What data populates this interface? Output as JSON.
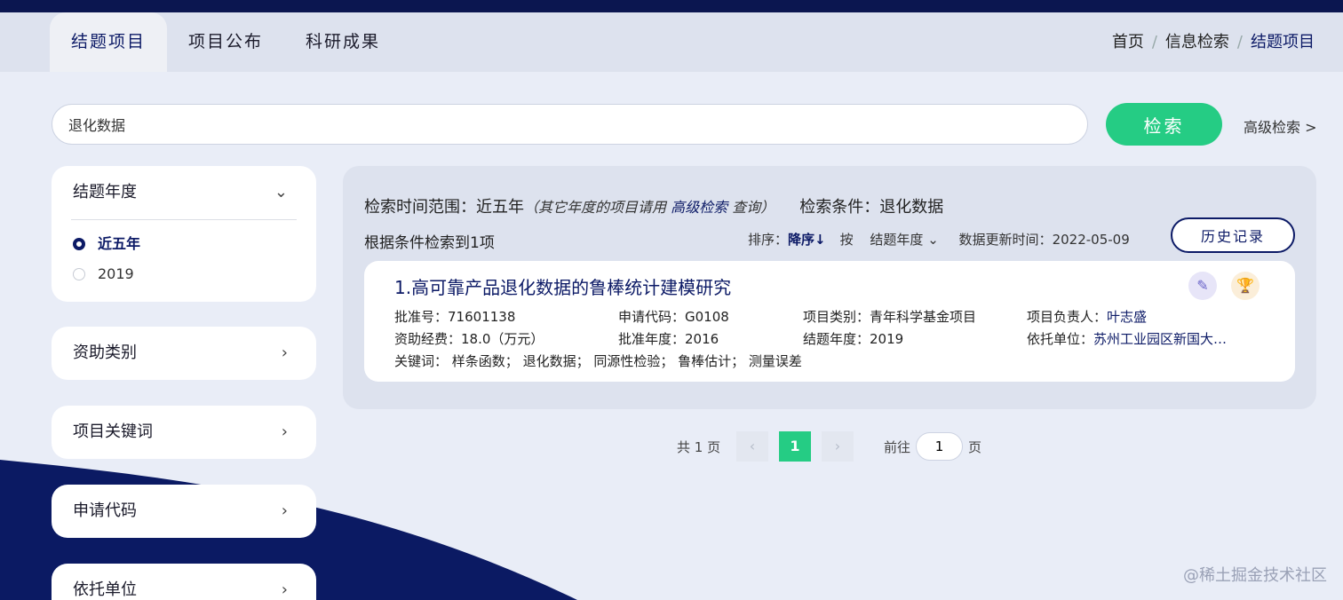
{
  "nav": {
    "tabs": [
      {
        "label": "结题项目"
      },
      {
        "label": "项目公布"
      },
      {
        "label": "科研成果"
      }
    ],
    "breadcrumb": [
      "首页",
      "信息检索",
      "结题项目"
    ],
    "breadcrumb_sep": "/"
  },
  "search": {
    "value": "退化数据",
    "button": "检索",
    "advanced": "高级检索 >"
  },
  "filters": {
    "year": {
      "title": "结题年度",
      "options": [
        "近五年",
        "2019"
      ],
      "selected": "近五年"
    },
    "collapsed": [
      "资助类别",
      "项目关键词",
      "申请代码",
      "依托单位"
    ]
  },
  "results": {
    "range_label": "检索时间范围：",
    "range_value": "近五年",
    "range_note_pre": "（其它年度的项目请用 ",
    "range_note_link": "高级检索",
    "range_note_post": " 查询）",
    "cond_label": "检索条件：",
    "cond_value": "退化数据",
    "count_text": "根据条件检索到1项",
    "sort_label": "排序：",
    "sort_dir": "降序↓",
    "by_label": "按",
    "by_field": "结题年度",
    "updated_label": "数据更新时间：",
    "updated_value": "2022-05-09",
    "history_button": "历史记录",
    "items": [
      {
        "title": "1.高可靠产品退化数据的鲁棒统计建模研究",
        "approval_no_label": "批准号：",
        "approval_no": "71601138",
        "apply_code_label": "申请代码：",
        "apply_code": "G0108",
        "category_label": "项目类别：",
        "category": "青年科学基金项目",
        "leader_label": "项目负责人：",
        "leader": "叶志盛",
        "funding_label": "资助经费：",
        "funding": "18.0（万元）",
        "approval_year_label": "批准年度：",
        "approval_year": "2016",
        "end_year_label": "结题年度：",
        "end_year": "2019",
        "unit_label": "依托单位：",
        "unit": "苏州工业园区新国大…",
        "keywords_label": "关键词：",
        "keywords": "样条函数； 退化数据； 同源性检验； 鲁棒估计； 测量误差"
      }
    ]
  },
  "pagination": {
    "total_text": "共 1 页",
    "current": "1",
    "goto_label": "前往",
    "goto_value": "1",
    "page_suffix": "页"
  },
  "watermark": "@稀土掘金技术社区",
  "colors": {
    "navy": "#0c1a66",
    "green": "#25cc84",
    "background": "#e9edf7"
  }
}
